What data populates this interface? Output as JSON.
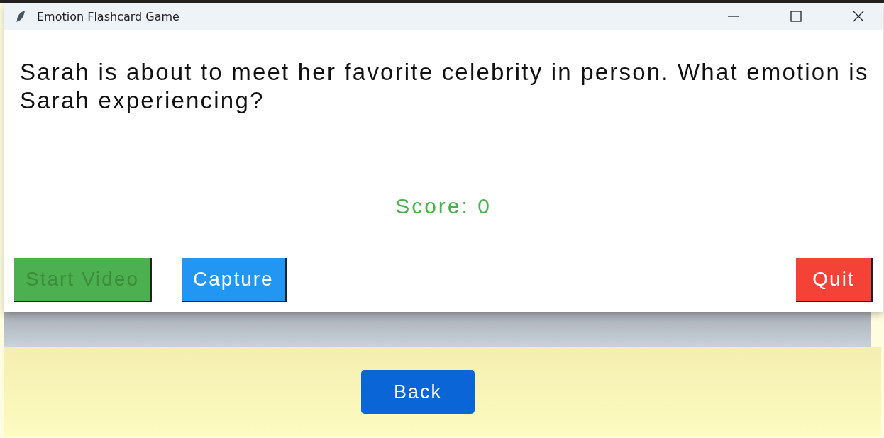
{
  "window": {
    "title": "Emotion Flashcard Game"
  },
  "question": "Sarah is about to meet her favorite celebrity in person. What emotion is Sarah experiencing?",
  "score": "Score: 0",
  "buttons": [
    {
      "label": "Start Video",
      "kind": "start",
      "disabled": true
    },
    {
      "label": "Capture",
      "kind": "capture",
      "disabled": false
    },
    {
      "label": "Quit",
      "kind": "quit",
      "disabled": false
    }
  ],
  "background_page": {
    "back_button": "Back"
  }
}
